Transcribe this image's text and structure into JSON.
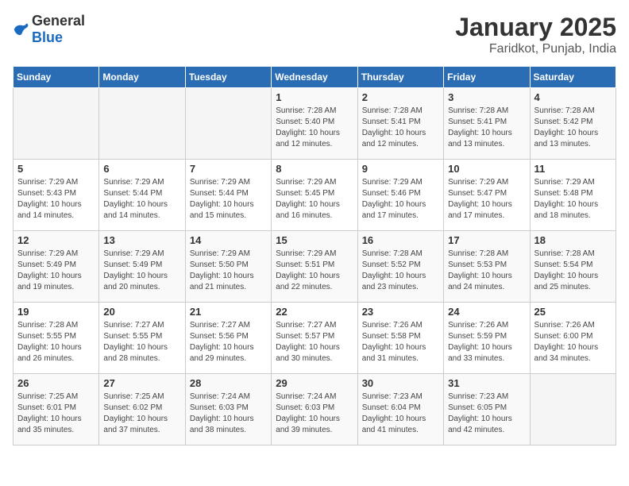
{
  "logo": {
    "general": "General",
    "blue": "Blue"
  },
  "title": "January 2025",
  "subtitle": "Faridkot, Punjab, India",
  "weekdays": [
    "Sunday",
    "Monday",
    "Tuesday",
    "Wednesday",
    "Thursday",
    "Friday",
    "Saturday"
  ],
  "weeks": [
    [
      {
        "day": "",
        "info": ""
      },
      {
        "day": "",
        "info": ""
      },
      {
        "day": "",
        "info": ""
      },
      {
        "day": "1",
        "info": "Sunrise: 7:28 AM\nSunset: 5:40 PM\nDaylight: 10 hours\nand 12 minutes."
      },
      {
        "day": "2",
        "info": "Sunrise: 7:28 AM\nSunset: 5:41 PM\nDaylight: 10 hours\nand 12 minutes."
      },
      {
        "day": "3",
        "info": "Sunrise: 7:28 AM\nSunset: 5:41 PM\nDaylight: 10 hours\nand 13 minutes."
      },
      {
        "day": "4",
        "info": "Sunrise: 7:28 AM\nSunset: 5:42 PM\nDaylight: 10 hours\nand 13 minutes."
      }
    ],
    [
      {
        "day": "5",
        "info": "Sunrise: 7:29 AM\nSunset: 5:43 PM\nDaylight: 10 hours\nand 14 minutes."
      },
      {
        "day": "6",
        "info": "Sunrise: 7:29 AM\nSunset: 5:44 PM\nDaylight: 10 hours\nand 14 minutes."
      },
      {
        "day": "7",
        "info": "Sunrise: 7:29 AM\nSunset: 5:44 PM\nDaylight: 10 hours\nand 15 minutes."
      },
      {
        "day": "8",
        "info": "Sunrise: 7:29 AM\nSunset: 5:45 PM\nDaylight: 10 hours\nand 16 minutes."
      },
      {
        "day": "9",
        "info": "Sunrise: 7:29 AM\nSunset: 5:46 PM\nDaylight: 10 hours\nand 17 minutes."
      },
      {
        "day": "10",
        "info": "Sunrise: 7:29 AM\nSunset: 5:47 PM\nDaylight: 10 hours\nand 17 minutes."
      },
      {
        "day": "11",
        "info": "Sunrise: 7:29 AM\nSunset: 5:48 PM\nDaylight: 10 hours\nand 18 minutes."
      }
    ],
    [
      {
        "day": "12",
        "info": "Sunrise: 7:29 AM\nSunset: 5:49 PM\nDaylight: 10 hours\nand 19 minutes."
      },
      {
        "day": "13",
        "info": "Sunrise: 7:29 AM\nSunset: 5:49 PM\nDaylight: 10 hours\nand 20 minutes."
      },
      {
        "day": "14",
        "info": "Sunrise: 7:29 AM\nSunset: 5:50 PM\nDaylight: 10 hours\nand 21 minutes."
      },
      {
        "day": "15",
        "info": "Sunrise: 7:29 AM\nSunset: 5:51 PM\nDaylight: 10 hours\nand 22 minutes."
      },
      {
        "day": "16",
        "info": "Sunrise: 7:28 AM\nSunset: 5:52 PM\nDaylight: 10 hours\nand 23 minutes."
      },
      {
        "day": "17",
        "info": "Sunrise: 7:28 AM\nSunset: 5:53 PM\nDaylight: 10 hours\nand 24 minutes."
      },
      {
        "day": "18",
        "info": "Sunrise: 7:28 AM\nSunset: 5:54 PM\nDaylight: 10 hours\nand 25 minutes."
      }
    ],
    [
      {
        "day": "19",
        "info": "Sunrise: 7:28 AM\nSunset: 5:55 PM\nDaylight: 10 hours\nand 26 minutes."
      },
      {
        "day": "20",
        "info": "Sunrise: 7:27 AM\nSunset: 5:55 PM\nDaylight: 10 hours\nand 28 minutes."
      },
      {
        "day": "21",
        "info": "Sunrise: 7:27 AM\nSunset: 5:56 PM\nDaylight: 10 hours\nand 29 minutes."
      },
      {
        "day": "22",
        "info": "Sunrise: 7:27 AM\nSunset: 5:57 PM\nDaylight: 10 hours\nand 30 minutes."
      },
      {
        "day": "23",
        "info": "Sunrise: 7:26 AM\nSunset: 5:58 PM\nDaylight: 10 hours\nand 31 minutes."
      },
      {
        "day": "24",
        "info": "Sunrise: 7:26 AM\nSunset: 5:59 PM\nDaylight: 10 hours\nand 33 minutes."
      },
      {
        "day": "25",
        "info": "Sunrise: 7:26 AM\nSunset: 6:00 PM\nDaylight: 10 hours\nand 34 minutes."
      }
    ],
    [
      {
        "day": "26",
        "info": "Sunrise: 7:25 AM\nSunset: 6:01 PM\nDaylight: 10 hours\nand 35 minutes."
      },
      {
        "day": "27",
        "info": "Sunrise: 7:25 AM\nSunset: 6:02 PM\nDaylight: 10 hours\nand 37 minutes."
      },
      {
        "day": "28",
        "info": "Sunrise: 7:24 AM\nSunset: 6:03 PM\nDaylight: 10 hours\nand 38 minutes."
      },
      {
        "day": "29",
        "info": "Sunrise: 7:24 AM\nSunset: 6:03 PM\nDaylight: 10 hours\nand 39 minutes."
      },
      {
        "day": "30",
        "info": "Sunrise: 7:23 AM\nSunset: 6:04 PM\nDaylight: 10 hours\nand 41 minutes."
      },
      {
        "day": "31",
        "info": "Sunrise: 7:23 AM\nSunset: 6:05 PM\nDaylight: 10 hours\nand 42 minutes."
      },
      {
        "day": "",
        "info": ""
      }
    ]
  ]
}
